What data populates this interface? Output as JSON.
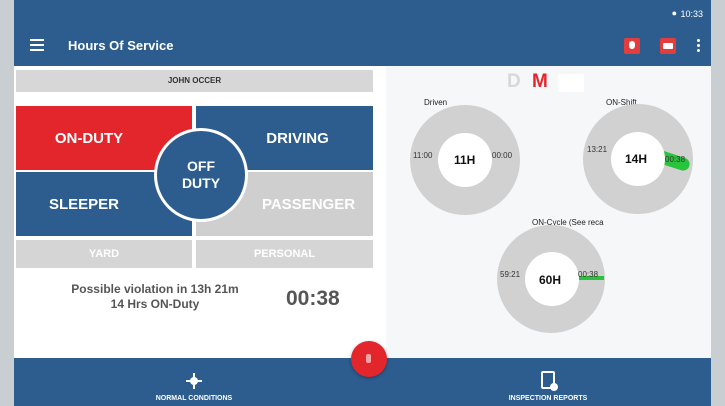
{
  "status_bar": {
    "time": "10:33",
    "location_icon": "location-pin-icon"
  },
  "app_bar": {
    "title": "Hours Of Service",
    "icons": [
      "menu-icon",
      "microphone-icon",
      "truck-icon",
      "more-vert-icon"
    ]
  },
  "driver": {
    "name": "JOHN OCCER"
  },
  "statuses": {
    "on_duty": "ON-DUTY",
    "driving": "DRIVING",
    "sleeper": "SLEEPER",
    "passenger": "PASSENGER",
    "off_duty_line1": "OFF",
    "off_duty_line2": "DUTY",
    "yard": "YARD",
    "personal": "PERSONAL"
  },
  "violation": {
    "line1": "Possible violation in 13h 21m",
    "line2": "14 Hrs ON-Duty",
    "timer": "00:38"
  },
  "mode_toggle": {
    "d": "D",
    "m": "M"
  },
  "gauges": {
    "driven": {
      "label": "Driven",
      "center": "11H",
      "left": "11:00",
      "right": "00:00",
      "used_fraction": 0
    },
    "on_shift": {
      "label": "ON-Shift",
      "center": "14H",
      "left": "13:21",
      "right": "00:38",
      "used_fraction": 0.045
    },
    "on_cycle": {
      "label": "ON-Cycle (See reca",
      "center": "60H",
      "left": "59:21",
      "right": "00:38",
      "used_fraction": 0.01
    }
  },
  "colors": {
    "primary": "#2d5c8e",
    "active": "#e3262b",
    "inactive": "#cfcfcf",
    "gauge_used": "#28c43c"
  },
  "bottom_nav": {
    "normal_conditions": "NORMAL CONDITIONS",
    "inspection_reports": "INSPECTION REPORTS"
  }
}
